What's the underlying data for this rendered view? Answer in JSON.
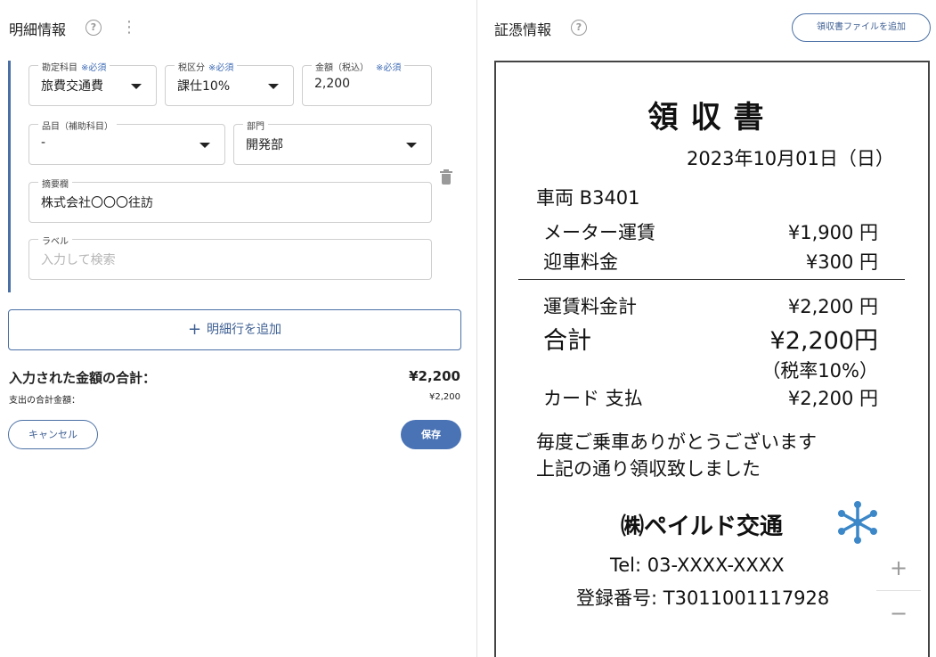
{
  "left": {
    "title": "明細情報",
    "help": "?",
    "menu": "⋮",
    "fields": {
      "account": {
        "label": "勘定科目",
        "required": "※必須",
        "value": "旅費交通費"
      },
      "tax": {
        "label": "税区分",
        "required": "※必須",
        "value": "課仕10%"
      },
      "amount": {
        "label": "金額（税込）",
        "required": "※必須",
        "value": "2,200"
      },
      "item": {
        "label": "品目（補助科目）",
        "value": "-"
      },
      "dept": {
        "label": "部門",
        "value": "開発部"
      },
      "memo": {
        "label": "摘要欄",
        "value": "株式会社〇〇〇往訪"
      },
      "tag": {
        "label": "ラベル",
        "placeholder": "入力して検索"
      }
    },
    "add_row": {
      "plus": "+",
      "label": "明細行を追加"
    },
    "total_label": "入力された金額の合計：",
    "total_value": "¥2,200",
    "sub_label": "支出の合計金額：",
    "sub_value": "¥2,200",
    "cancel": "キャンセル",
    "save": "保存"
  },
  "right": {
    "title": "証憑情報",
    "help": "?",
    "attach_button": "領収書ファイルを追加",
    "receipt": {
      "title": "領収書",
      "date": "2023年10月01日（日）",
      "vehicle": "車両 B3401",
      "meter_label": "メーター運賃",
      "meter_value": "¥1,900 円",
      "pickup_label": "迎車料金",
      "pickup_value": "¥300 円",
      "subtotal_label": "運賃料金計",
      "subtotal_value": "¥2,200 円",
      "total_label": "合計",
      "total_value": "¥2,200円",
      "tax_rate": "（税率10%）",
      "card_label": "カード 支払",
      "card_value": "¥2,200 円",
      "thanks1": "毎度ご乗車ありがとうございます",
      "thanks2": "上記の通り領収致しました",
      "company": "㈱ペイルド交通",
      "tel": "Tel: 03-XXXX-XXXX",
      "reg_no": "登録番号: T3011001117928"
    },
    "zoom_in": "+",
    "zoom_out": "−"
  },
  "colors": {
    "accent": "#4a6fa5",
    "save_bg": "#4a73b5",
    "logo": "#3b87c8"
  }
}
